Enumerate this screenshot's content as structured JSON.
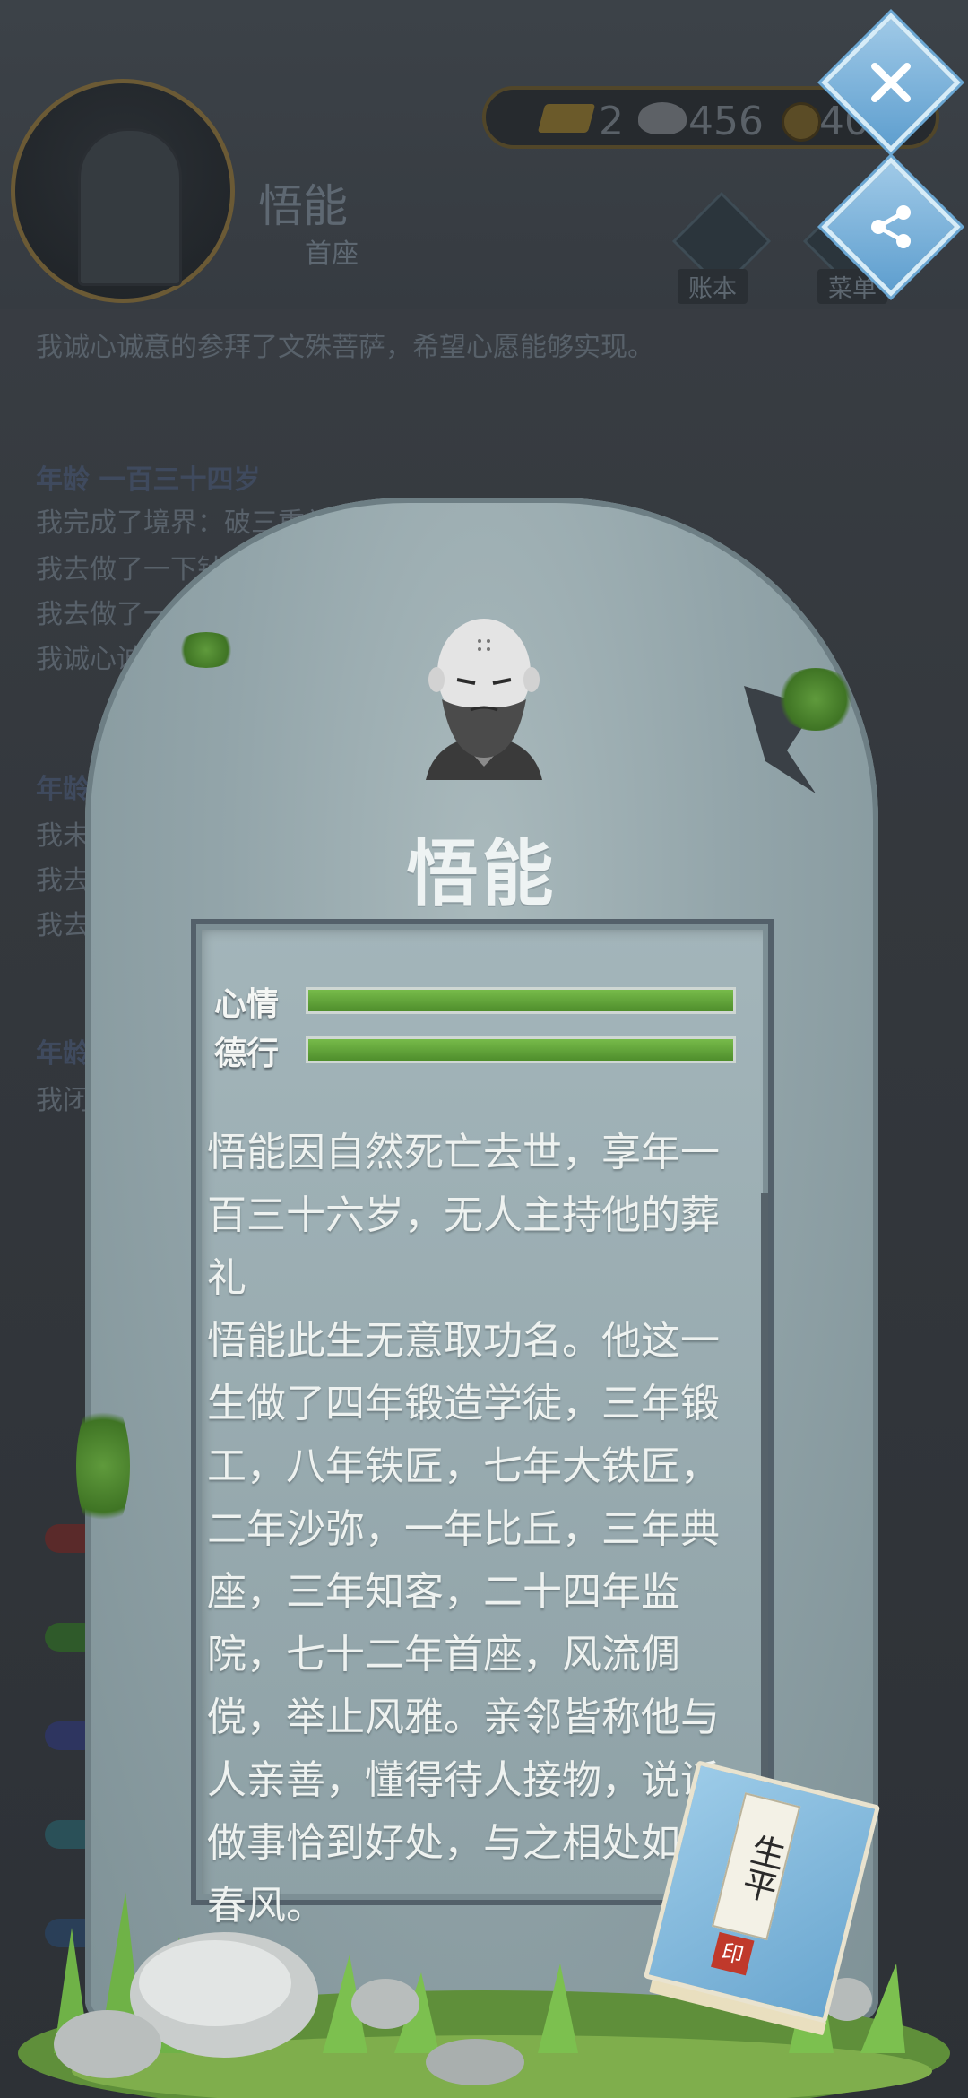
{
  "header": {
    "name": "悟能",
    "rank": "首座",
    "currency": {
      "gold": "2",
      "silver": "456",
      "coin": "407"
    },
    "ledger_label": "账本",
    "menu_label": "菜单"
  },
  "log": {
    "top_line": "我诚心诚意的参拜了文殊菩萨，希望心愿能够实现。",
    "age_header_1": "年龄 一百三十四岁",
    "lines_1": [
      "我完成了境界：破三重关",
      "我去做了一下针",
      "我去做了一下",
      "我诚心诚意"
    ],
    "age_header_2": "年龄",
    "lines_2": [
      "我未",
      "我去",
      "我去"
    ],
    "age_header_3": "年龄",
    "lines_3": [
      "我闭"
    ]
  },
  "tombstone": {
    "name": "悟能",
    "stats": [
      {
        "label": "心情",
        "value": 1.0
      },
      {
        "label": "德行",
        "value": 1.0
      }
    ],
    "bio": [
      "悟能因自然死亡去世，享年一百三十六岁，无人主持他的葬礼",
      "悟能此生无意取功名。他这一生做了四年锻造学徒，三年锻工，八年铁匠，七年大铁匠，二年沙弥，一年比丘，三年典座，三年知客，二十四年监院，七十二年首座，风流倜傥，举止风雅。亲邻皆称他与人亲善，懂得待人接物，说话做事恰到好处，与之相处如沐春风。"
    ]
  },
  "book": {
    "title": "生平",
    "seal": "印"
  },
  "colors": {
    "accent": "#6aa6cf",
    "bar_fill": "#5f9f38",
    "stone": "#93a5aa"
  }
}
